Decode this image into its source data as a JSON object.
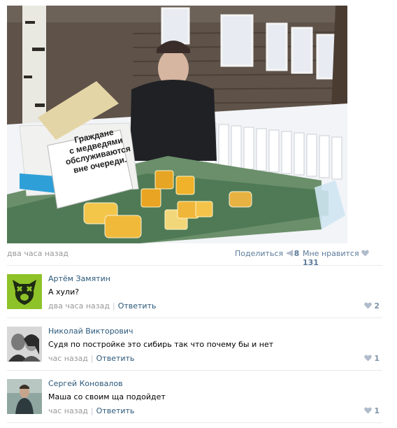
{
  "post": {
    "sign_text": [
      "Граждане",
      "с медведями",
      "обслуживаются",
      "вне очереди."
    ],
    "time": "два часа назад",
    "share_label": "Поделиться",
    "share_count": "8",
    "like_label": "Мне нравится",
    "like_count": "131"
  },
  "comments": [
    {
      "author": "Артём Замятин",
      "text": "А хули?",
      "time": "два часа назад",
      "reply": "Ответить",
      "likes": "2",
      "avatar": "dog-mascot-icon"
    },
    {
      "author": "Николай Викторович",
      "text": "Судя по постройке это сибирь так что почему бы и нет",
      "time": "час назад",
      "reply": "Ответить",
      "likes": "1",
      "avatar": "couple-photo"
    },
    {
      "author": "Сергей Коновалов",
      "text": "Маша со своим ща подойдет",
      "time": "час назад",
      "reply": "Ответить",
      "likes": "1",
      "avatar": "man-photo"
    }
  ],
  "colors": {
    "link": "#2b587a",
    "muted": "#999999",
    "heart": "#b0bccb",
    "avatar_green": "#8ec229"
  }
}
